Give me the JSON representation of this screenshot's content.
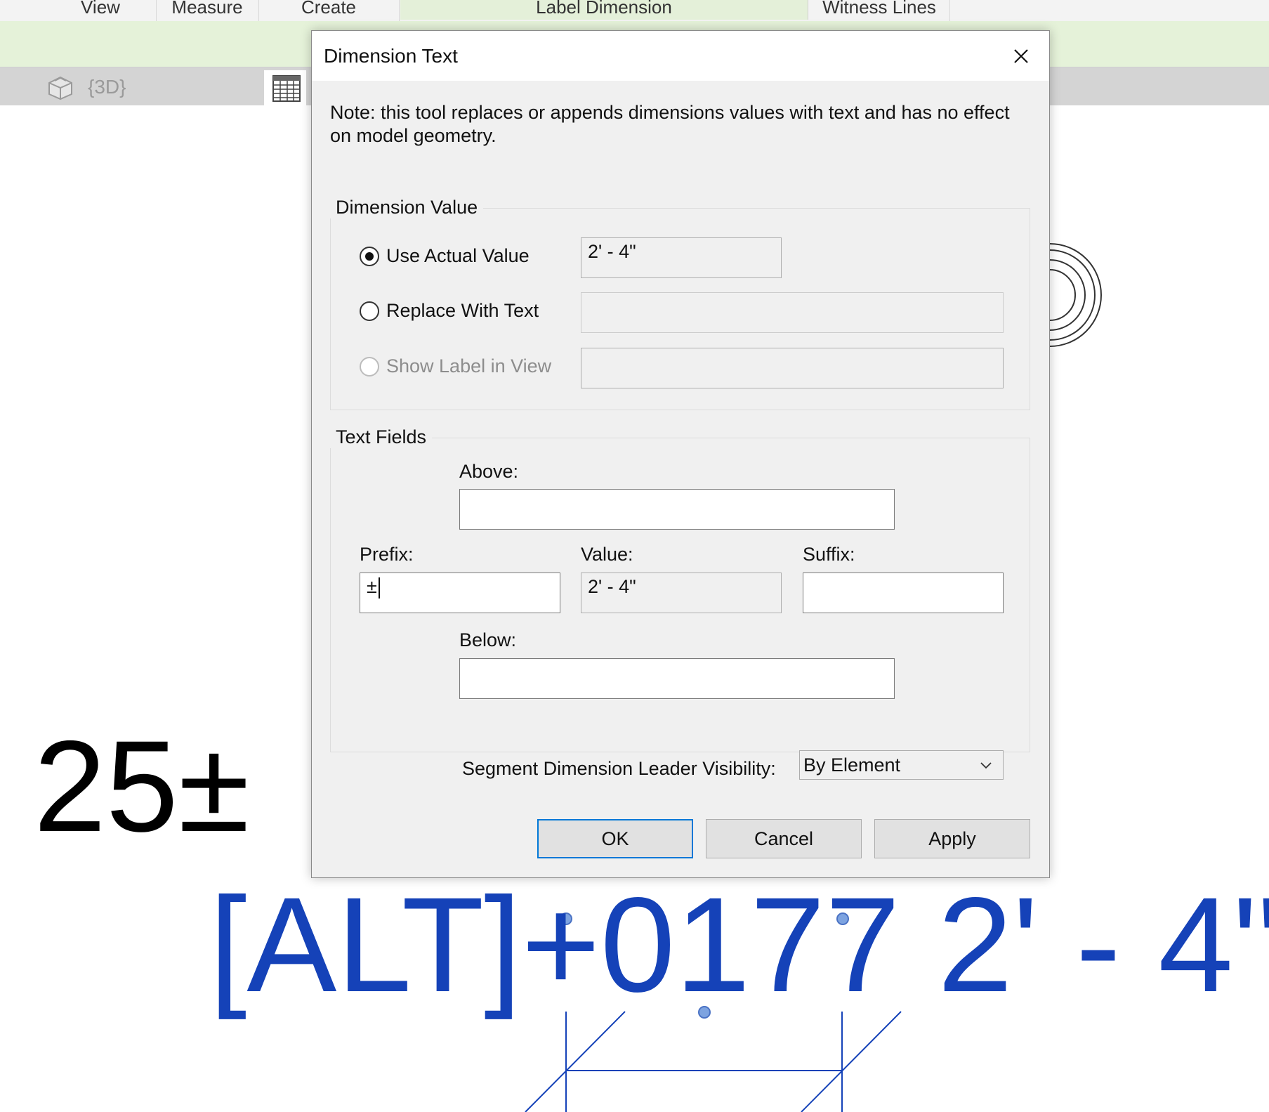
{
  "ribbon": {
    "tabs": [
      "View",
      "Measure",
      "Create",
      "Label Dimension",
      "Witness Lines"
    ]
  },
  "view_tabs": {
    "active": "{3D}"
  },
  "canvas": {
    "sample_text": "25±",
    "dimension_text": "[ALT]+0177 2' - 4\""
  },
  "dialog": {
    "title": "Dimension Text",
    "note": "Note: this tool replaces or appends dimensions values with text and has no effect on model geometry.",
    "dimension_value": {
      "group_label": "Dimension Value",
      "options": [
        {
          "label": "Use Actual Value",
          "checked": true,
          "enabled": true,
          "field_value": "2' - 4\""
        },
        {
          "label": "Replace With Text",
          "checked": false,
          "enabled": true,
          "field_value": ""
        },
        {
          "label": "Show Label in View",
          "checked": false,
          "enabled": false,
          "field_value": ""
        }
      ]
    },
    "text_fields": {
      "group_label": "Text Fields",
      "above_label": "Above:",
      "above_value": "",
      "prefix_label": "Prefix:",
      "prefix_value": "±",
      "value_label": "Value:",
      "value_value": "2' - 4\"",
      "suffix_label": "Suffix:",
      "suffix_value": "",
      "below_label": "Below:",
      "below_value": ""
    },
    "leader": {
      "label": "Segment Dimension Leader Visibility:",
      "selected": "By Element"
    },
    "buttons": {
      "ok": "OK",
      "cancel": "Cancel",
      "apply": "Apply"
    }
  },
  "colors": {
    "dimension_blue": "#1542b8",
    "ribbon_green": "#e5f2d9",
    "accent": "#0078d7"
  }
}
